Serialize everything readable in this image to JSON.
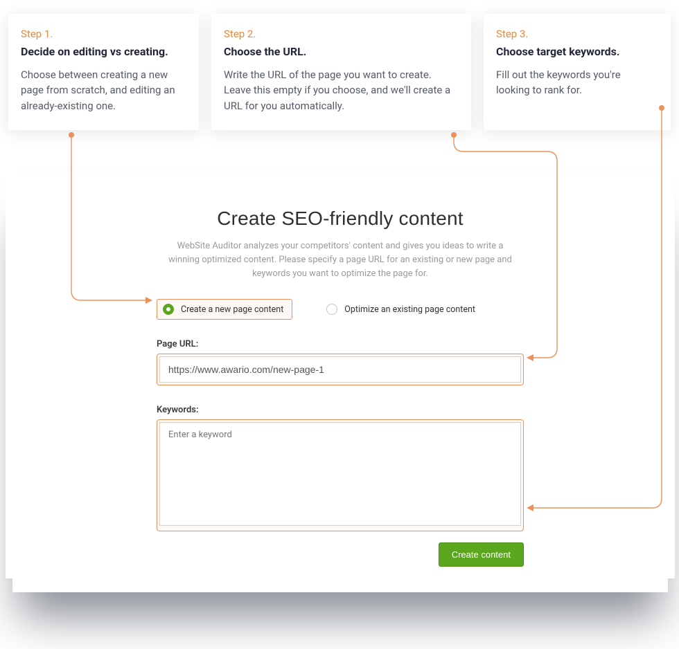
{
  "steps": [
    {
      "num": "Step 1.",
      "title": "Decide on editing vs creating.",
      "body": "Choose between creating a new page from scratch, and editing an already-existing one."
    },
    {
      "num": "Step 2.",
      "title": "Choose the URL.",
      "body": "Write the URL of the page you want to create. Leave this empty if you choose, and we'll create a URL for you automatically."
    },
    {
      "num": "Step 3.",
      "title": "Choose target keywords.",
      "body": "Fill out the keywords you're looking to rank for."
    }
  ],
  "panel": {
    "heading": "Create SEO-friendly content",
    "description": "WebSite Auditor analyzes your competitors' content and gives you ideas to write a winning optimized content. Please specify a page URL for an existing or new page and keywords you want to optimize the page for.",
    "radio_create": "Create a new page content",
    "radio_optimize": "Optimize an existing page content",
    "url_label": "Page URL:",
    "url_value": "https://www.awario.com/new-page-1",
    "kw_label": "Keywords:",
    "kw_placeholder": "Enter a keyword",
    "button": "Create content"
  }
}
